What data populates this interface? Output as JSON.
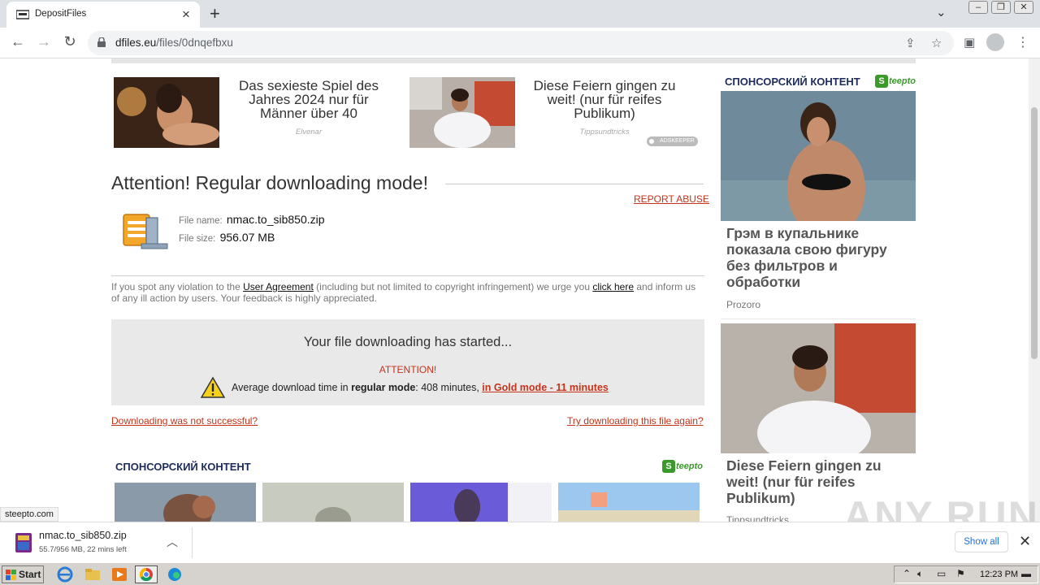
{
  "browser": {
    "tab_title": "DepositFiles",
    "url_host": "dfiles.eu",
    "url_path": "/files/0dnqefbxu"
  },
  "ads": [
    {
      "text": "Das sexieste Spiel des Jahres 2024 nur für Männer über 40",
      "source": "Elvenar"
    },
    {
      "text": "Diese Feiern gingen zu weit! (nur für reifes Publikum)",
      "source": "Tippsundtricks"
    }
  ],
  "adskeeper_label": "ADSKEEPER",
  "page": {
    "title": "Attention! Regular downloading mode!",
    "report_abuse": "REPORT ABUSE",
    "file_name_label": "File name:",
    "file_name": "nmac.to_sib850.zip",
    "file_size_label": "File size:",
    "file_size": "956.07 MB",
    "notice_1": "If you spot any violation to the ",
    "notice_link_1": "User Agreement",
    "notice_2": " (including but not limited to copyright infringement) we urge you ",
    "notice_link_2": "click here",
    "notice_3": " and inform us of any ill action by users. Your feedback is highly appreciated.",
    "download_started": "Your file downloading has started...",
    "attention_label": "ATTENTION!",
    "avg_prefix": "Average download time in ",
    "avg_mode": "regular mode",
    "avg_suffix": ": 408 minutes, ",
    "gold_mode_link": "in Gold mode - 11 minutes",
    "not_successful_link": "Downloading was not successful?",
    "try_again_link": "Try downloading this file again?",
    "sponsor_heading": "СПОНСОРСКИЙ КОНТЕНТ",
    "steepto_brand": "teepto"
  },
  "right_column": {
    "sponsor_heading": "СПОНСОРСКИЙ КОНТЕНТ",
    "cards": [
      {
        "title": "Грэм в купальнике показала свою фигуру без фильтров и обработки",
        "source": "Prozoro"
      },
      {
        "title": "Diese Feiern gingen zu weit! (nur für reifes Publikum)",
        "source": "Tippsundtricks"
      }
    ]
  },
  "status_url": "steepto.com",
  "watermark": "ANY RUN",
  "download_shelf": {
    "file_name": "nmac.to_sib850.zip",
    "status": "55.7/956 MB, 22 mins left",
    "show_all": "Show all"
  },
  "taskbar": {
    "start_label": "Start",
    "clock": "12:23 PM"
  }
}
